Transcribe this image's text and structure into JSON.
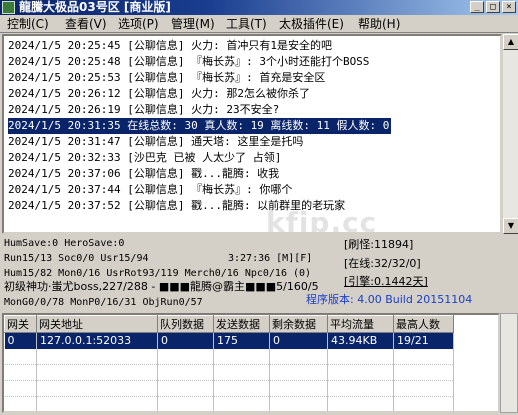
{
  "window": {
    "title": "龍騰大极品03号区 [商业版]",
    "controls": {
      "minimize": "_",
      "maximize": "□",
      "close": "×"
    }
  },
  "menu": {
    "items": [
      {
        "label": "控制(C)"
      },
      {
        "label": "查看(V)"
      },
      {
        "label": "选项(P)"
      },
      {
        "label": "管理(M)"
      },
      {
        "label": "工具(T)"
      },
      {
        "label": "太极插件(E)"
      },
      {
        "label": "帮助(H)"
      }
    ]
  },
  "log": {
    "lines": [
      {
        "text": "2024/1/5 20:25:45 [公聊信息] 火力: 首冲只有1是安全的吧",
        "selected": false
      },
      {
        "text": "2024/1/5 20:25:48 [公聊信息] 『梅长苏』: 3个小时还能打个BOSS",
        "selected": false
      },
      {
        "text": "2024/1/5 20:25:53 [公聊信息] 『梅长苏』: 首充是安全区",
        "selected": false
      },
      {
        "text": "2024/1/5 20:26:12 [公聊信息] 火力: 那2怎么被你杀了",
        "selected": false
      },
      {
        "text": "2024/1/5 20:26:19 [公聊信息] 火力: 23不安全?",
        "selected": false
      },
      {
        "text": "2024/1/5 20:31:35 在线总数: 30 真人数: 19 离线数: 11 假人数: 0",
        "selected": true
      },
      {
        "text": "2024/1/5 20:31:47 [公聊信息] 通天塔: 这里全是托吗",
        "selected": false
      },
      {
        "text": "2024/1/5 20:32:33 [沙巴克 已被 人太少了 占领]",
        "selected": false
      },
      {
        "text": "2024/1/5 20:37:06 [公聊信息] 戳...龍腾: 收我",
        "selected": false
      },
      {
        "text": "2024/1/5 20:37:44 [公聊信息] 『梅长苏』: 你哪个",
        "selected": false
      },
      {
        "text": "2024/1/5 20:37:52 [公聊信息] 戳...龍腾: 以前群里的老玩家",
        "selected": false
      }
    ]
  },
  "watermark": "kfip.cc",
  "stats": {
    "hum_save": "HumSave:0 HeroSave:0",
    "run": "Run15/13 Soc0/0 Usr15/94",
    "clock": "3:27:36 [M][F]",
    "hum": "Hum15/82 Mon0/16 UsrRot93/119 Merch0/16 Npc0/16 (0)",
    "boss": "初级神功·蚩尤boss,227/288 - ■■■龍腾@霸主■■■5/160/5",
    "mon": "MonG0/0/78 MonP0/16/31 ObjRun0/57",
    "refresh": "[刷怪:11894]",
    "online": "[在线:32/32/0]",
    "engine": "[引擎:0.1442天]",
    "version": "程序版本: 4.00 Build 20151104"
  },
  "gateway_table": {
    "headers": [
      "网关",
      "网关地址",
      "队列数据",
      "发送数据",
      "剩余数据",
      "平均流量",
      "最高人数"
    ],
    "rows": [
      [
        "0",
        "127.0.0.1:52033",
        "0",
        "175",
        "0",
        "43.94KB",
        "19/21"
      ]
    ]
  },
  "colors": {
    "selection": "#0a246a",
    "version_text": "#1a3ec8",
    "window_bg": "#d4d0c8"
  }
}
